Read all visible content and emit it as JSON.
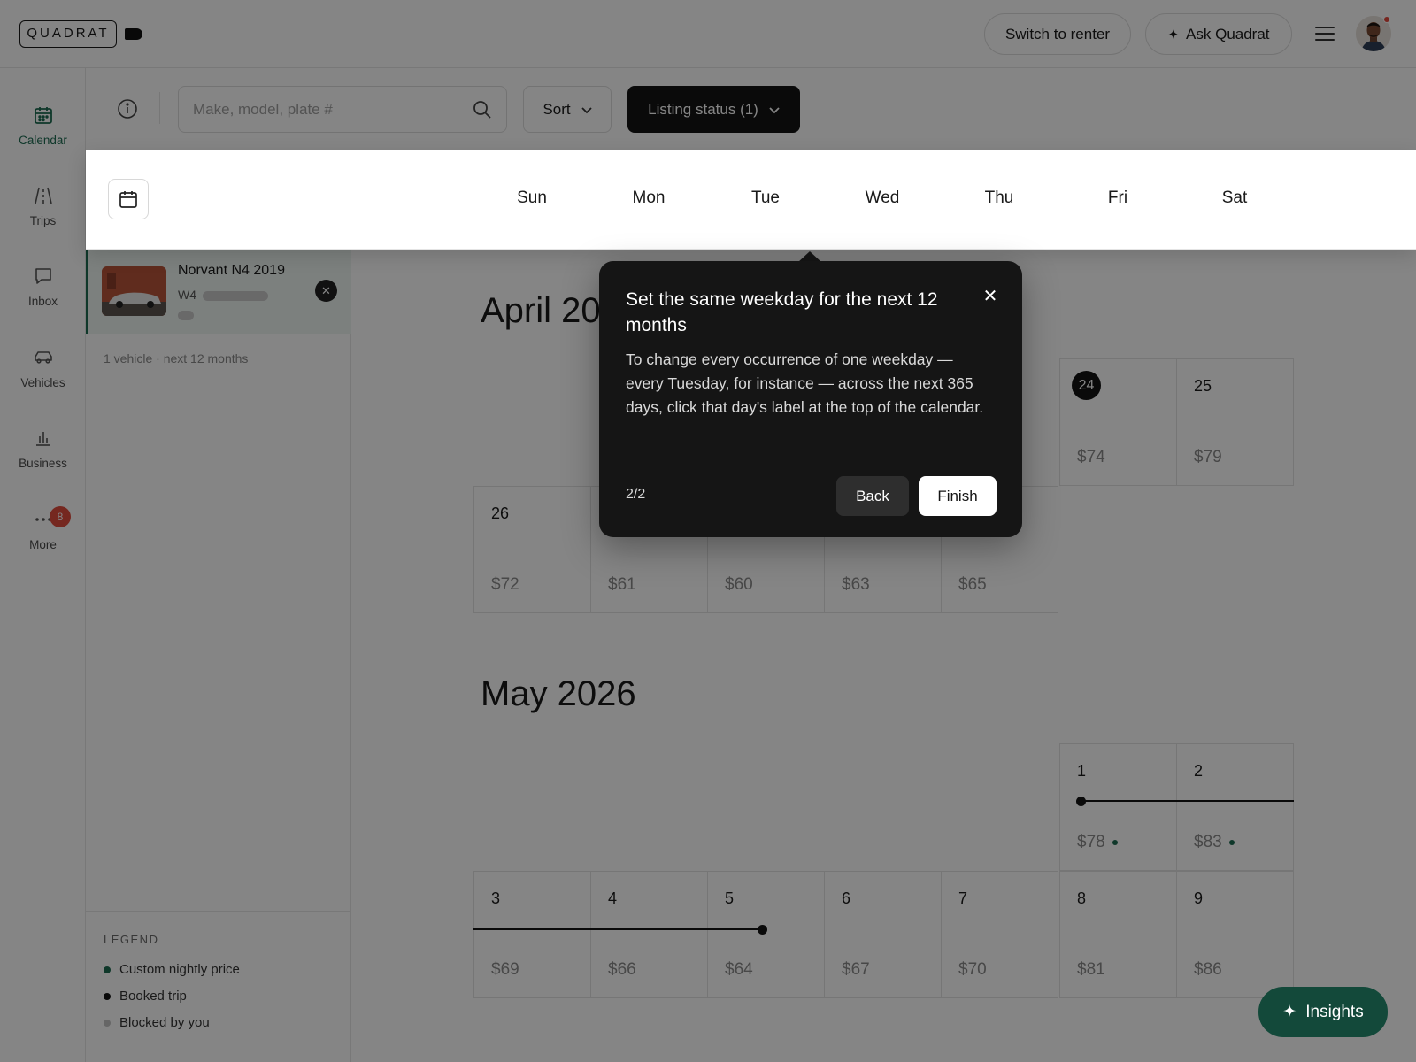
{
  "header": {
    "logo_text": "QUADRAT",
    "switch_label": "Switch to renter",
    "ask_label": "Ask Quadrat"
  },
  "nav": {
    "calendar": "Calendar",
    "trips": "Trips",
    "inbox": "Inbox",
    "vehicles": "Vehicles",
    "business": "Business",
    "more": "More",
    "more_badge": "8"
  },
  "toolbar": {
    "search_placeholder": "Make, model, plate #",
    "sort_label": "Sort",
    "status_label": "Listing status (1)"
  },
  "vehicle": {
    "name": "Norvant N4 2019",
    "plate_prefix": "W4",
    "meta": "1 vehicle · next 12 months"
  },
  "weekdays": [
    "Sun",
    "Mon",
    "Tue",
    "Wed",
    "Thu",
    "Fri",
    "Sat"
  ],
  "april": {
    "title": "April 2026",
    "row1": [
      {
        "day": "24",
        "price": "$74",
        "today": true
      },
      {
        "day": "25",
        "price": "$79"
      }
    ],
    "row2": [
      {
        "day": "26",
        "price": "$72"
      },
      {
        "day": "",
        "price": "$61"
      },
      {
        "day": "",
        "price": "$60"
      },
      {
        "day": "",
        "price": "$63"
      },
      {
        "day": "",
        "price": "$65"
      }
    ]
  },
  "may": {
    "title": "May 2026",
    "row1": [
      {
        "day": "1",
        "price": "$78",
        "custom": true
      },
      {
        "day": "2",
        "price": "$83",
        "custom": true
      }
    ],
    "row2": [
      {
        "day": "3",
        "price": "$69"
      },
      {
        "day": "4",
        "price": "$66"
      },
      {
        "day": "5",
        "price": "$64"
      },
      {
        "day": "6",
        "price": "$67"
      },
      {
        "day": "7",
        "price": "$70"
      },
      {
        "day": "8",
        "price": "$81"
      },
      {
        "day": "9",
        "price": "$86"
      }
    ]
  },
  "legend": {
    "title": "LEGEND",
    "items": [
      "Custom nightly price",
      "Booked trip",
      "Blocked by you"
    ],
    "colors": [
      "#1d6b52",
      "#141414",
      "#c4c4c4"
    ]
  },
  "popover": {
    "title": "Set the same weekday for the next 12 months",
    "body": "To change every occurrence of one weekday — every Tuesday, for instance — across the next 365 days, click that day's label at the top of the calendar.",
    "step": "2/2",
    "back": "Back",
    "finish": "Finish"
  },
  "insights_label": "Insights",
  "colors": {
    "accent": "#1d6b52",
    "badge": "#e04d3f",
    "insights_bg": "#13493a"
  }
}
